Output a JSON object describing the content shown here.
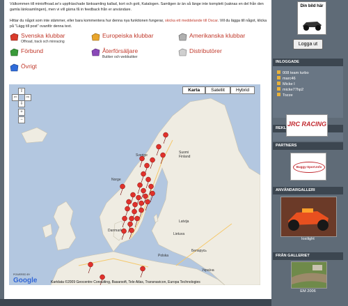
{
  "intro": {
    "p1": "Välkommen till minioffroad.se's uppfräschade länksamling kallad, kort och gott, Katalogen. Samligen är än så länge inte komplett (saknas en del från den gamla länksamlingen), men vi vill gärna få in feedback från er användare.",
    "p2_start": "Hittar du något som inte stämmer, eller bara kommentera hur denna nya funktionen fungerar, ",
    "p2_link": "skicka ett meddelande till Oscar",
    "p2_end": ". Vill du lägga till något, klicka på \"Lägg till post\" ovanför denna text."
  },
  "categories": [
    {
      "label": "Svenska klubbar",
      "sub": "Offroad, track och minracing",
      "color": "#d93b2b"
    },
    {
      "label": "Europeiska klubbar",
      "sub": "",
      "color": "#e8a52c"
    },
    {
      "label": "Amerikanska klubbar",
      "sub": "",
      "color": "#b0b0b0"
    },
    {
      "label": "Förbund",
      "sub": "",
      "color": "#3a9a3a"
    },
    {
      "label": "Återförsäljare",
      "sub": "Butiker och webbutiker",
      "color": "#8a49b8"
    },
    {
      "label": "Distributörer",
      "sub": "",
      "color": "#cfcfcf"
    },
    {
      "label": "Övrigt",
      "sub": "",
      "color": "#2f6bd9"
    }
  ],
  "map": {
    "buttons": [
      "Karta",
      "Satellit",
      "Hybrid"
    ],
    "nav": [
      "⇧",
      "⇦",
      "⇨",
      "⇩",
      "+",
      "−"
    ],
    "labels": [
      "Sverige",
      "Suomi Finland",
      "Norge",
      "Danmark",
      "Polska",
      "Беларусь",
      "Україна",
      "Latvija",
      "Lietuva"
    ],
    "copyright": "Kartdata ©2009 Geocentre Consulting, Basarsoft, Tele Atlas, Transnavicon, Europa Technologies",
    "powered": "POWERED BY",
    "google": "Google"
  },
  "sidebar": {
    "avatar_text": "Din bild här",
    "logout": "Logga ut",
    "inloggade_title": "INLOGGADE",
    "users": [
      "008 team turbo",
      "marc46",
      "Micke I",
      "micke77hp2",
      "Tozze"
    ],
    "reklam_title": "REKLAM",
    "reklam_logo": "JRC RACING",
    "partners_title": "PARTNERS",
    "partners_logo": "Buggy-Sport.Info",
    "gallery_title": "ANVÄNDARGALLERI",
    "gallery_caption": "losilight",
    "fran_title": "FRÅN GALLERIET",
    "fran_caption": "EM 2006"
  }
}
